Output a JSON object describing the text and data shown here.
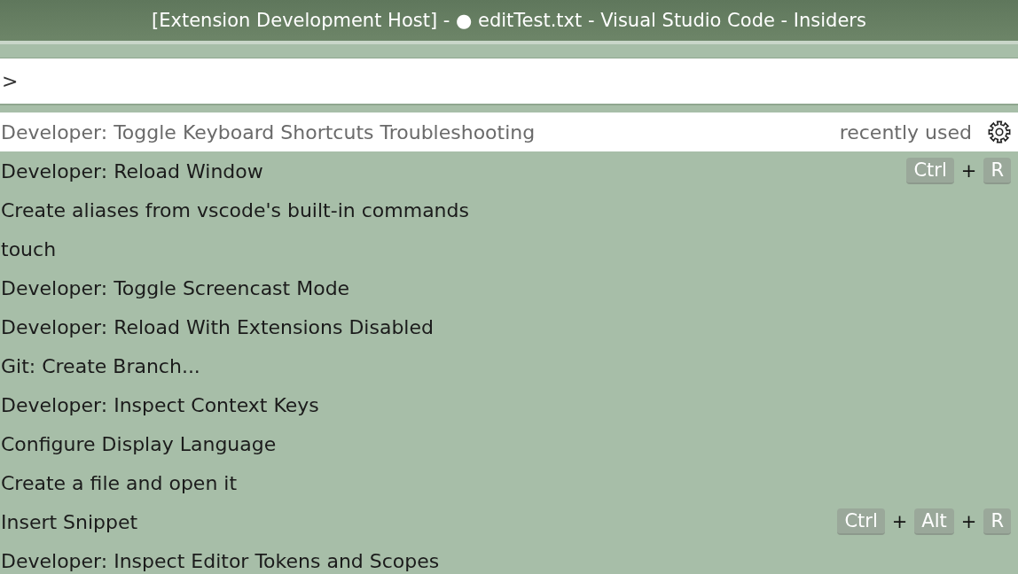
{
  "window": {
    "title": "[Extension Development Host] - ● editTest.txt - Visual Studio Code - Insiders"
  },
  "command_input": {
    "value": ">"
  },
  "commands": [
    {
      "label": "Developer: Toggle Keyboard Shortcuts Troubleshooting",
      "selected": true,
      "detail": "recently used"
    },
    {
      "label": "Developer: Reload Window",
      "selected": false,
      "keybinding": [
        {
          "kind": "key",
          "text": "Ctrl"
        },
        {
          "kind": "sep",
          "text": "+"
        },
        {
          "kind": "key",
          "text": "R"
        }
      ]
    },
    {
      "label": "Create aliases from vscode's built-in commands",
      "selected": false
    },
    {
      "label": "touch",
      "selected": false
    },
    {
      "label": "Developer: Toggle Screencast Mode",
      "selected": false
    },
    {
      "label": "Developer: Reload With Extensions Disabled",
      "selected": false
    },
    {
      "label": "Git: Create Branch...",
      "selected": false
    },
    {
      "label": "Developer: Inspect Context Keys",
      "selected": false
    },
    {
      "label": "Configure Display Language",
      "selected": false
    },
    {
      "label": "Create a file and open it",
      "selected": false
    },
    {
      "label": "Insert Snippet",
      "selected": false,
      "keybinding": [
        {
          "kind": "key",
          "text": "Ctrl"
        },
        {
          "kind": "sep",
          "text": "+"
        },
        {
          "kind": "key",
          "text": "Alt"
        },
        {
          "kind": "sep",
          "text": "+"
        },
        {
          "kind": "key",
          "text": "R"
        }
      ]
    },
    {
      "label": "Developer: Inspect Editor Tokens and Scopes",
      "selected": false
    }
  ]
}
